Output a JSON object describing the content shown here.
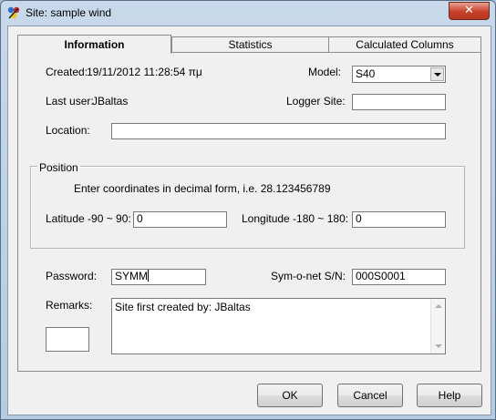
{
  "window": {
    "title": "Site: sample wind",
    "close_glyph": "✕"
  },
  "tabs": [
    {
      "label": "Information",
      "active": true
    },
    {
      "label": "Statistics",
      "active": false
    },
    {
      "label": "Calculated Columns",
      "active": false
    }
  ],
  "info": {
    "created_label": "Created:",
    "created_value": "19/11/2012 11:28:54 πμ",
    "model_label": "Model:",
    "model_value": "S40",
    "last_user_label": "Last user:",
    "last_user_value": "JBaltas",
    "logger_site_label": "Logger Site:",
    "logger_site_value": "",
    "location_label": "Location:",
    "location_value": ""
  },
  "position": {
    "group_label": "Position",
    "hint": "Enter coordinates in decimal form, i.e. 28.123456789",
    "latitude_label": "Latitude -90 ~ 90:",
    "latitude_value": "0",
    "longitude_label": "Longitude -180 ~ 180:",
    "longitude_value": "0"
  },
  "security": {
    "password_label": "Password:",
    "password_value": "SYMM",
    "symonet_label": "Sym-o-net S/N:",
    "symonet_value": "000S0001"
  },
  "remarks": {
    "label": "Remarks:",
    "value": "Site first created by: JBaltas"
  },
  "buttons": {
    "ok": "OK",
    "cancel": "Cancel",
    "help": "Help"
  }
}
